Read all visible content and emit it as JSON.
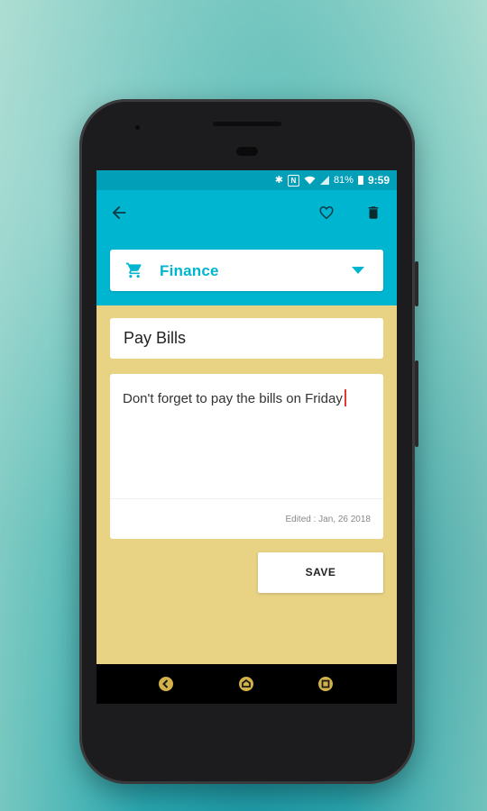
{
  "status_bar": {
    "battery_text": "81%",
    "time": "9:59",
    "nfc_label": "N"
  },
  "icons": {
    "back": "arrow-back-icon",
    "favorite": "heart-outline-icon",
    "delete": "trash-icon",
    "category": "shopping-cart-icon",
    "dropdown": "triangle-down-icon"
  },
  "category_selector": {
    "selected": "Finance"
  },
  "note": {
    "title": "Pay Bills",
    "body": "Don't forget to pay the bills on Friday",
    "edited": "Edited : Jan, 26 2018"
  },
  "actions": {
    "save_label": "SAVE"
  },
  "colors": {
    "accent": "#00b5d0",
    "status_bar": "#029fb9",
    "note_background": "#e8d283"
  }
}
